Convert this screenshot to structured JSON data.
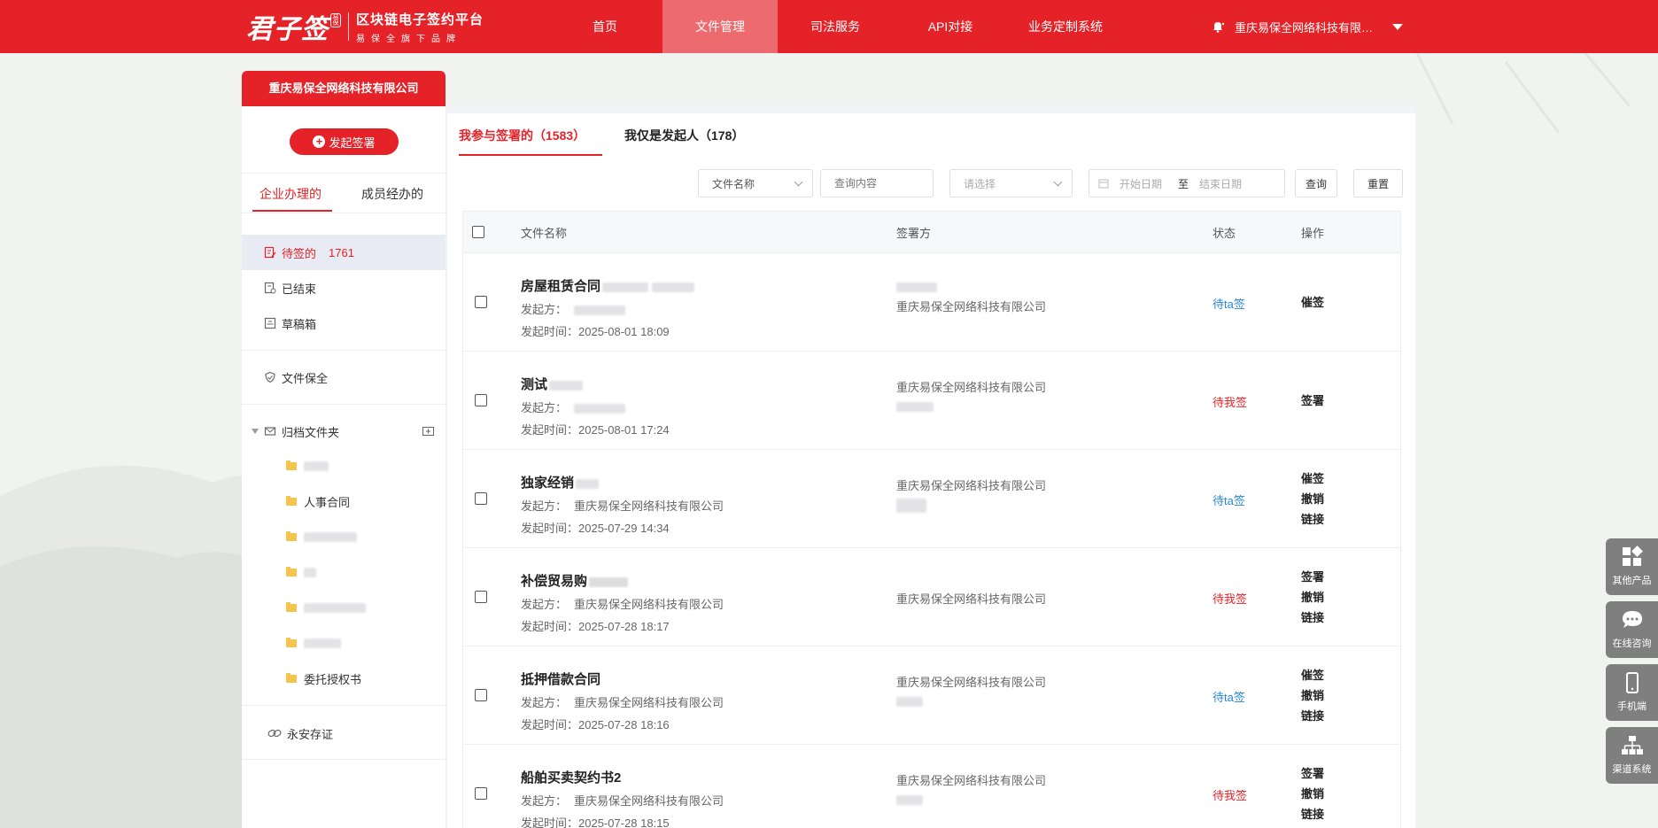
{
  "header": {
    "logo": {
      "brand": "君子签",
      "seal": "易保",
      "title": "区块链电子签约平台",
      "subtitle": "易保全旗下品牌"
    },
    "nav": [
      {
        "label": "首页",
        "active": false
      },
      {
        "label": "文件管理",
        "active": true
      },
      {
        "label": "司法服务",
        "active": false
      },
      {
        "label": "API对接",
        "active": false
      },
      {
        "label": "业务定制系统",
        "active": false
      }
    ],
    "user_name": "重庆易保全网络科技有限公司",
    "bell_icon": "bell-icon",
    "dropdown_icon": "caret-down-icon"
  },
  "sidebar": {
    "company_tab": "重庆易保全网络科技有限公司",
    "start_button": "发起签署",
    "tabs": [
      {
        "label": "企业办理的",
        "active": true
      },
      {
        "label": "成员经办的",
        "active": false
      }
    ],
    "menu": [
      {
        "label": "待签的",
        "count": "1761",
        "icon": "edit-doc-icon",
        "active": true
      },
      {
        "label": "已结束",
        "count": "",
        "icon": "doc-done-icon",
        "active": false
      },
      {
        "label": "草稿箱",
        "count": "",
        "icon": "draft-box-icon",
        "active": false
      },
      {
        "label": "文件保全",
        "count": "",
        "icon": "shield-check-icon",
        "active": false
      }
    ],
    "archive": {
      "label": "归档文件夹",
      "icon": "envelope-folder-icon",
      "add_icon": "add-folder-icon"
    },
    "folders": [
      {
        "label": "",
        "blurred": true
      },
      {
        "label": "人事合同",
        "blurred": false
      },
      {
        "label": "",
        "blurred": true
      },
      {
        "label": "",
        "blurred": true
      },
      {
        "label": "",
        "blurred": true
      },
      {
        "label": "",
        "blurred": true
      },
      {
        "label": "委托授权书",
        "blurred": false
      }
    ],
    "forever": {
      "label": "永安存证",
      "icon": "link-chain-icon"
    }
  },
  "main": {
    "tabs": [
      {
        "label": "我参与签署的（1583）",
        "active": true
      },
      {
        "label": "我仅是发起人（178）",
        "active": false
      }
    ],
    "filters": {
      "field_select": "文件名称",
      "query_placeholder": "查询内容",
      "status_placeholder": "请选择",
      "start_date_placeholder": "开始日期",
      "range_sep": "至",
      "end_date_placeholder": "结束日期",
      "search_button": "查询",
      "reset_button": "重置"
    },
    "table": {
      "headers": {
        "name": "文件名称",
        "party": "签署方",
        "status": "状态",
        "action": "操作"
      },
      "initiator_label": "发起方：",
      "time_label": "发起时间：",
      "rows": [
        {
          "title": "房屋租赁合同",
          "initiator": "",
          "time": "2025-08-01 18:09",
          "parties": [
            "",
            "重庆易保全网络科技有限公司"
          ],
          "status": "待ta签",
          "status_kind": "blue",
          "actions": [
            "催签"
          ]
        },
        {
          "title": "测试",
          "initiator": "",
          "time": "2025-08-01 17:24",
          "parties": [
            "重庆易保全网络科技有限公司",
            ""
          ],
          "status": "待我签",
          "status_kind": "red",
          "actions": [
            "签署"
          ]
        },
        {
          "title": "独家经销",
          "initiator": "重庆易保全网络科技有限公司",
          "time": "2025-07-29 14:34",
          "parties": [
            "重庆易保全网络科技有限公司",
            ""
          ],
          "status": "待ta签",
          "status_kind": "blue",
          "actions": [
            "催签",
            "撤销",
            "链接"
          ]
        },
        {
          "title": "补偿贸易购",
          "initiator": "重庆易保全网络科技有限公司",
          "time": "2025-07-28 18:17",
          "parties": [
            "重庆易保全网络科技有限公司"
          ],
          "status": "待我签",
          "status_kind": "red",
          "actions": [
            "签署",
            "撤销",
            "链接"
          ]
        },
        {
          "title": "抵押借款合同",
          "initiator": "重庆易保全网络科技有限公司",
          "time": "2025-07-28 18:16",
          "parties": [
            "重庆易保全网络科技有限公司",
            ""
          ],
          "status": "待ta签",
          "status_kind": "blue",
          "actions": [
            "催签",
            "撤销",
            "链接"
          ]
        },
        {
          "title": "船舶买卖契约书2",
          "initiator": "重庆易保全网络科技有限公司",
          "time": "2025-07-28 18:15",
          "parties": [
            "重庆易保全网络科技有限公司",
            ""
          ],
          "status": "待我签",
          "status_kind": "red",
          "actions": [
            "签署",
            "撤销",
            "链接"
          ]
        }
      ]
    }
  },
  "float_panel": [
    {
      "label": "其他产品",
      "icon": "grid-apps-icon"
    },
    {
      "label": "在线咨询",
      "icon": "chat-bubble-icon"
    },
    {
      "label": "手机端",
      "icon": "mobile-phone-icon"
    },
    {
      "label": "渠道系统",
      "icon": "org-tree-icon"
    }
  ],
  "colors": {
    "brand_red": "#e52227",
    "nav_active": "#ed6b6e",
    "status_blue": "#2a87d3",
    "menu_active_bg": "#e8ebf3"
  }
}
